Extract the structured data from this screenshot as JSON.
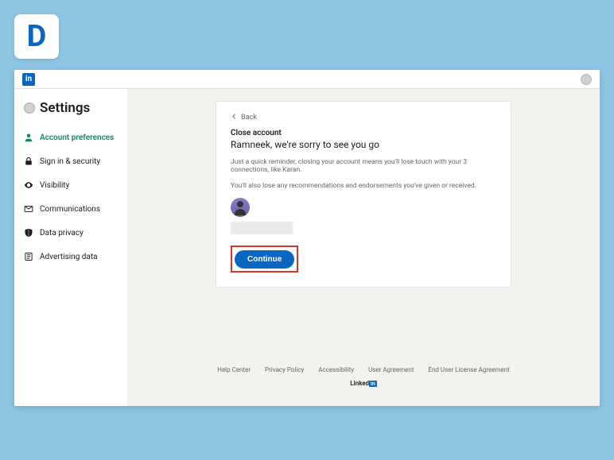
{
  "outer_logo": "D",
  "topbar": {
    "brand_glyph": "in"
  },
  "sidebar": {
    "title": "Settings",
    "items": [
      {
        "label": "Account preferences",
        "active": true
      },
      {
        "label": "Sign in & security",
        "active": false
      },
      {
        "label": "Visibility",
        "active": false
      },
      {
        "label": "Communications",
        "active": false
      },
      {
        "label": "Data privacy",
        "active": false
      },
      {
        "label": "Advertising data",
        "active": false
      }
    ]
  },
  "card": {
    "back_label": "Back",
    "section_label": "Close account",
    "heading": "Ramneek, we're sorry to see you go",
    "reminder_text": "Just a quick reminder, closing your account means you'll lose touch with your 3 connections, like Karan.",
    "lose_text": "You'll also lose any recommendations and endorsements you've given or received.",
    "continue_label": "Continue"
  },
  "footer": {
    "links": [
      "Help Center",
      "Privacy Policy",
      "Accessibility",
      "User Agreement",
      "End User License Agreement"
    ],
    "brand_prefix": "Linked",
    "brand_suffix": "in"
  }
}
